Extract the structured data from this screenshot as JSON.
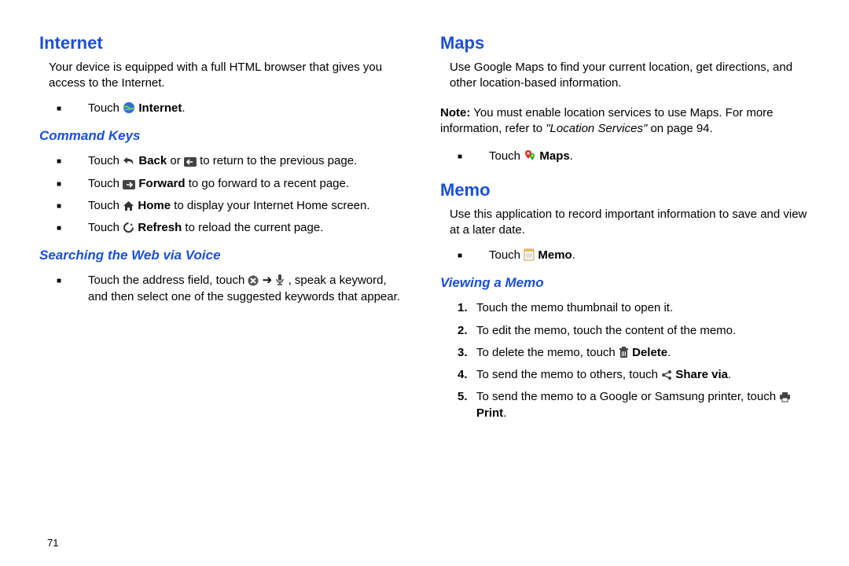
{
  "page_number": "71",
  "left": {
    "h_internet": "Internet",
    "p_internet": "Your device is equipped with a full HTML browser that gives you access to the Internet.",
    "touch": "Touch ",
    "internet_bold": "Internet",
    "dot": ".",
    "h_command": "Command Keys",
    "ck1_a": "Touch ",
    "ck1_b": " Back",
    "ck1_c": " or ",
    "ck1_d": " to return to the previous page.",
    "ck2_a": "Touch ",
    "ck2_b": " Forward",
    "ck2_c": " to go forward to a recent page.",
    "ck3_a": "Touch ",
    "ck3_b": " Home",
    "ck3_c": " to display your Internet Home screen.",
    "ck4_a": "Touch ",
    "ck4_b": " Refresh",
    "ck4_c": " to reload the current page.",
    "h_search": "Searching the Web via Voice",
    "sv1_a": "Touch the address field, touch ",
    "sv1_b": " ➔ ",
    "sv1_c": ", speak a keyword, and then select one of the suggested keywords that appear."
  },
  "right": {
    "h_maps": "Maps",
    "p_maps": "Use Google Maps to find your current location, get directions, and other location-based information.",
    "note_label": "Note:",
    "note_a": " You must enable location services to use Maps. For more information, refer to ",
    "note_ref": "\"Location Services\"",
    "note_b": " on page 94.",
    "touch": "Touch ",
    "maps_bold": " Maps",
    "dot": ".",
    "h_memo": "Memo",
    "p_memo": "Use this application to record important information to save and view at a later date.",
    "memo_bold": " Memo",
    "h_view": "Viewing a Memo",
    "v1": "Touch the memo thumbnail to open it.",
    "v2": "To edit the memo, touch the content of the memo.",
    "v3_a": "To delete the memo, touch ",
    "v3_b": " Delete",
    "v4_a": "To send the memo to others, touch ",
    "v4_b": " Share via",
    "v5_a": "To send the memo to a Google or Samsung printer, touch ",
    "v5_b": " Print",
    "n1": "1.",
    "n2": "2.",
    "n3": "3.",
    "n4": "4.",
    "n5": "5."
  }
}
